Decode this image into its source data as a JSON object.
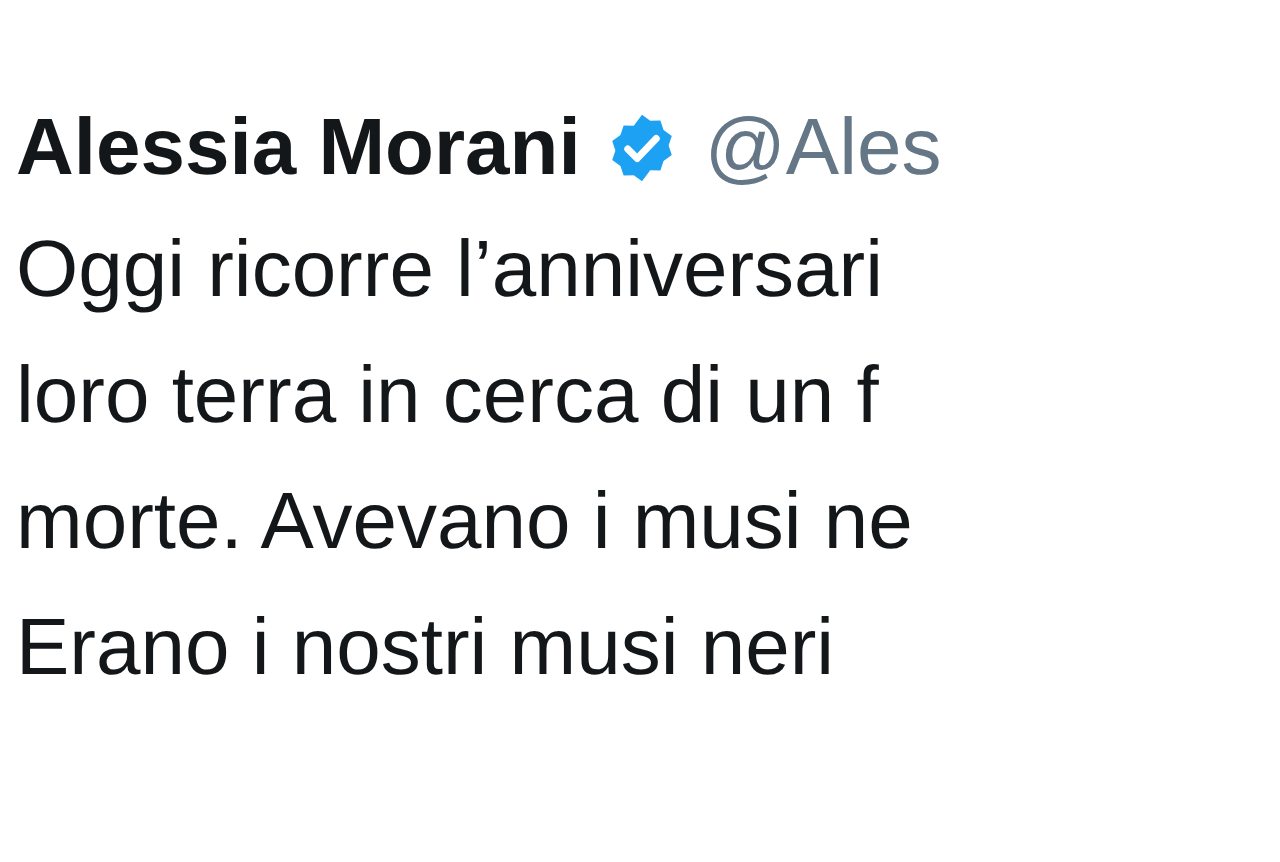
{
  "author": {
    "name": "Alessia Morani",
    "verified": true,
    "handle": "@Ales"
  },
  "text_lines": [
    "Oggi ricorre l’anniversari",
    "loro terra in cerca di un f",
    "morte. Avevano i musi ne",
    "Erano i nostri musi neri"
  ]
}
